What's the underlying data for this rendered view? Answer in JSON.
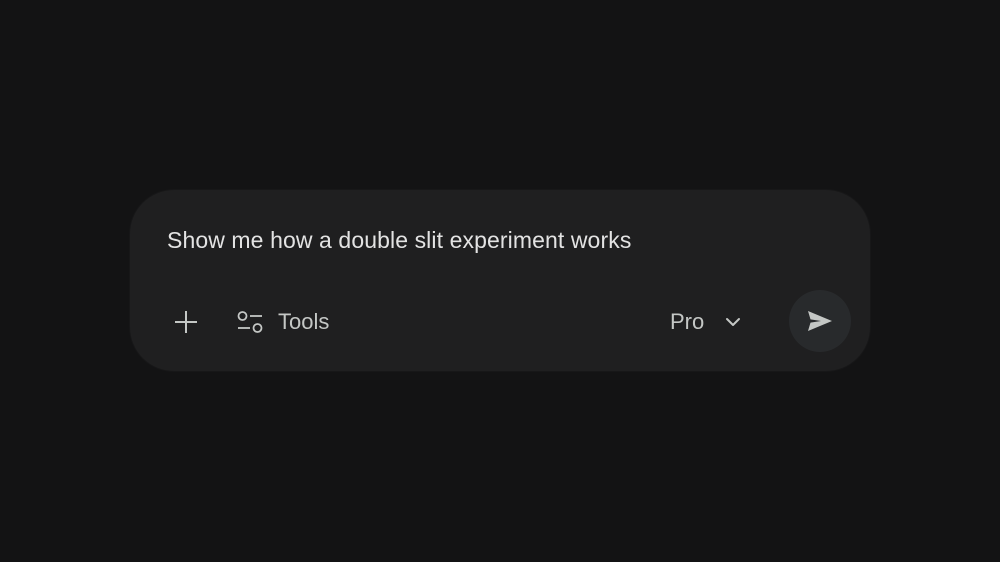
{
  "prompt": {
    "text": "Show me how a double slit experiment works"
  },
  "toolbar": {
    "add_icon": "plus-icon",
    "tools_icon": "tools-sliders-icon",
    "tools_label": "Tools",
    "model_label": "Pro",
    "model_dropdown_icon": "chevron-down-icon",
    "send_icon": "send-arrow-icon"
  },
  "colors": {
    "background": "#131314",
    "input_surface": "#1f1f20",
    "send_button_bg": "#282a2c",
    "text_primary": "#e3e3e3",
    "text_secondary": "#c4c7c5"
  }
}
